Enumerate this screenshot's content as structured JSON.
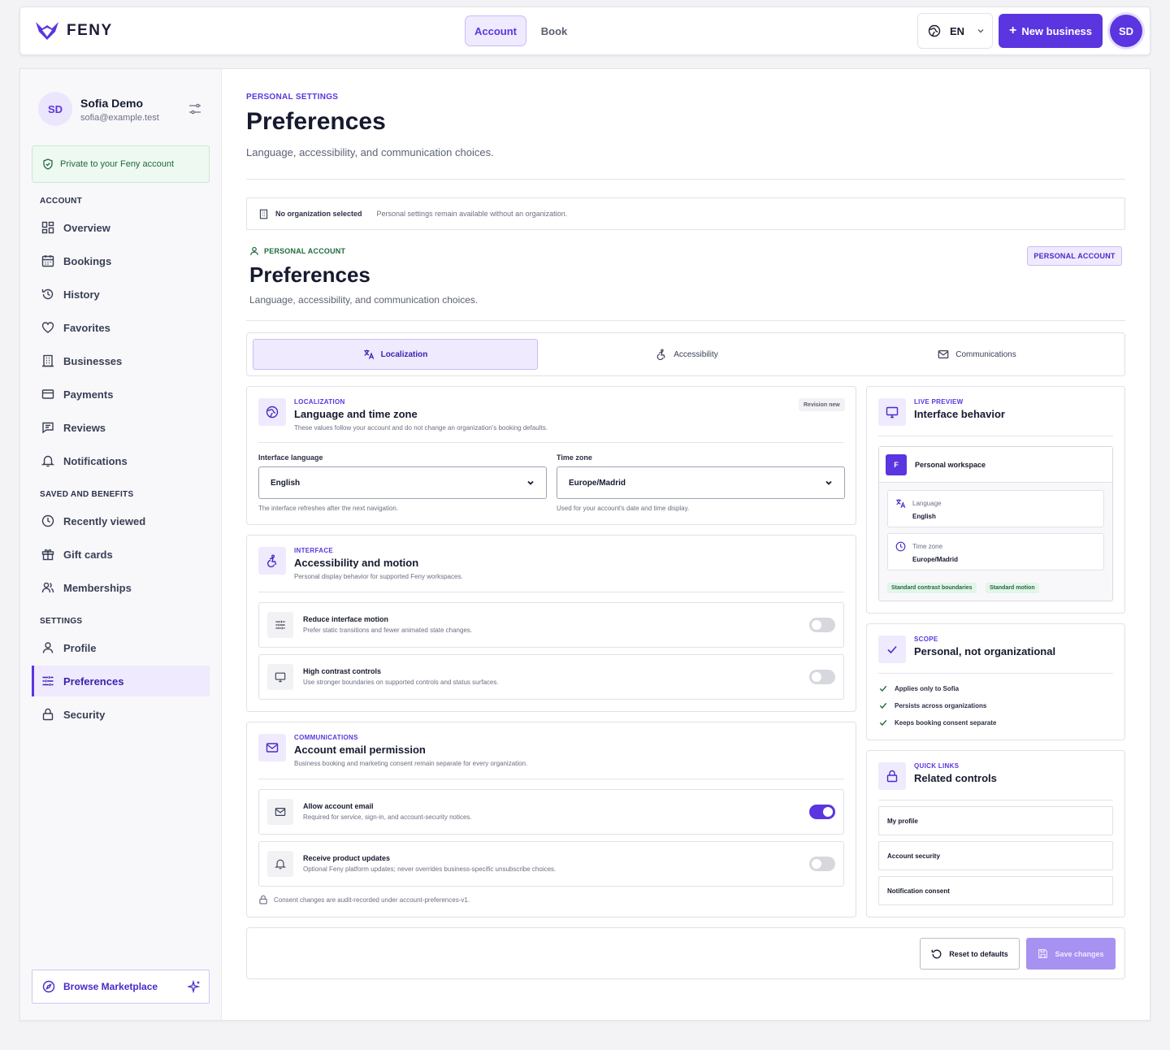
{
  "brand": {
    "name": "FENY"
  },
  "topnav": {
    "tabs": [
      {
        "label": "Account",
        "active": true
      },
      {
        "label": "Book",
        "active": false
      }
    ],
    "language": "EN",
    "new_business": "New business",
    "avatar_initials": "SD"
  },
  "sidebar": {
    "user": {
      "initials": "SD",
      "name": "Sofia Demo",
      "email": "sofia@example.test"
    },
    "privacy_note": "Private to your Feny account",
    "sections": {
      "account": "ACCOUNT",
      "saved": "SAVED AND BENEFITS",
      "settings": "SETTINGS"
    },
    "items": [
      {
        "label": "Overview",
        "icon": "grid-icon"
      },
      {
        "label": "Bookings",
        "icon": "calendar-icon"
      },
      {
        "label": "History",
        "icon": "history-icon"
      },
      {
        "label": "Favorites",
        "icon": "heart-icon"
      },
      {
        "label": "Businesses",
        "icon": "building-icon"
      },
      {
        "label": "Payments",
        "icon": "credit-card-icon"
      },
      {
        "label": "Reviews",
        "icon": "message-icon"
      },
      {
        "label": "Notifications",
        "icon": "bell-icon"
      },
      {
        "label": "Recently viewed",
        "icon": "clock-icon"
      },
      {
        "label": "Gift cards",
        "icon": "gift-icon"
      },
      {
        "label": "Memberships",
        "icon": "users-icon"
      },
      {
        "label": "Profile",
        "icon": "user-icon"
      },
      {
        "label": "Preferences",
        "icon": "sliders-icon",
        "active": true
      },
      {
        "label": "Security",
        "icon": "lock-icon"
      }
    ],
    "browse": "Browse Marketplace"
  },
  "page": {
    "kicker": "PERSONAL SETTINGS",
    "title": "Preferences",
    "subtitle": "Language, accessibility, and communication choices."
  },
  "org_bar": {
    "label": "No organization selected",
    "text": "Personal settings remain available without an organization."
  },
  "personal_account": {
    "kicker": "PERSONAL ACCOUNT",
    "badge": "PERSONAL ACCOUNT",
    "title": "Preferences",
    "subtitle": "Language, accessibility, and communication choices."
  },
  "tabs": [
    {
      "label": "Localization",
      "icon": "translate-icon",
      "active": true
    },
    {
      "label": "Accessibility",
      "icon": "accessibility-icon",
      "active": false
    },
    {
      "label": "Communications",
      "icon": "mail-icon",
      "active": false
    }
  ],
  "localization": {
    "kicker": "LOCALIZATION",
    "title": "Language and time zone",
    "subtitle": "These values follow your account and do not change an organization's booking defaults.",
    "revision": "Revision new",
    "language_label": "Interface language",
    "language_value": "English",
    "language_hint": "The interface refreshes after the next navigation.",
    "timezone_label": "Time zone",
    "timezone_value": "Europe/Madrid",
    "timezone_hint": "Used for your account's date and time display."
  },
  "interface": {
    "kicker": "INTERFACE",
    "title": "Accessibility and motion",
    "subtitle": "Personal display behavior for supported Feny workspaces.",
    "toggles": [
      {
        "title": "Reduce interface motion",
        "subtitle": "Prefer static transitions and fewer animated state changes.",
        "on": false
      },
      {
        "title": "High contrast controls",
        "subtitle": "Use stronger boundaries on supported controls and status surfaces.",
        "on": false
      }
    ]
  },
  "communications": {
    "kicker": "COMMUNICATIONS",
    "title": "Account email permission",
    "subtitle": "Business booking and marketing consent remain separate for every organization.",
    "toggles": [
      {
        "title": "Allow account email",
        "subtitle": "Required for service, sign-in, and account-security notices.",
        "on": true
      },
      {
        "title": "Receive product updates",
        "subtitle": "Optional Feny platform updates; never overrides business-specific unsubscribe choices.",
        "on": false
      }
    ],
    "note": "Consent changes are audit-recorded under account-preferences-v1."
  },
  "live_preview": {
    "kicker": "LIVE PREVIEW",
    "title": "Interface behavior",
    "workspace_logo": "F",
    "workspace_name": "Personal workspace",
    "language_label": "Language",
    "language_value": "English",
    "timezone_label": "Time zone",
    "timezone_value": "Europe/Madrid",
    "pills": [
      "Standard contrast boundaries",
      "Standard motion"
    ]
  },
  "scope": {
    "kicker": "SCOPE",
    "title": "Personal, not organizational",
    "items": [
      "Applies only to Sofia",
      "Persists across organizations",
      "Keeps booking consent separate"
    ]
  },
  "quick_links": {
    "kicker": "QUICK LINKS",
    "title": "Related controls",
    "links": [
      "My profile",
      "Account security",
      "Notification consent"
    ]
  },
  "footer": {
    "reset": "Reset to defaults",
    "save": "Save changes"
  },
  "colors": {
    "accent": "#5b35e0",
    "accent_soft": "#efeafe",
    "success": "#1f6b3c"
  }
}
